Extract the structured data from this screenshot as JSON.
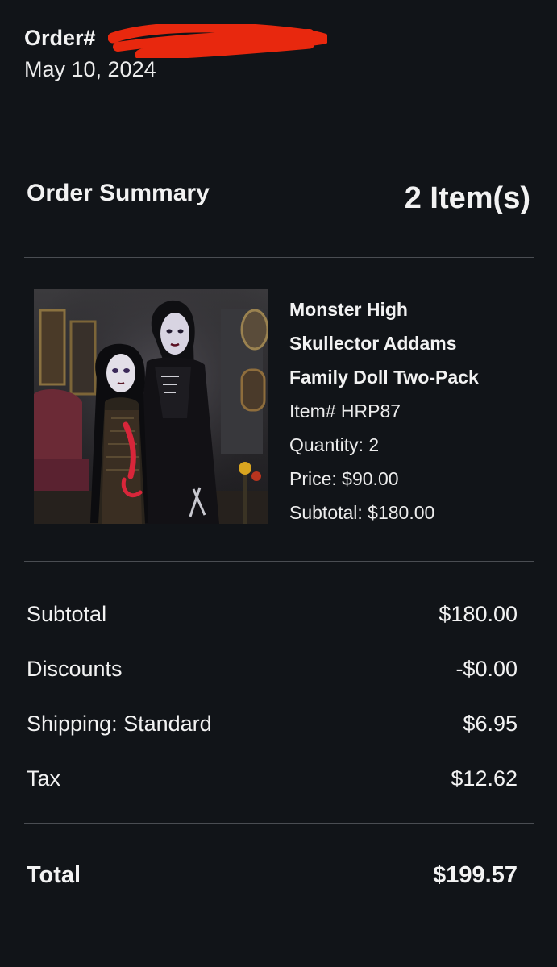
{
  "order": {
    "number_label": "Order#",
    "date": "May 10, 2024"
  },
  "summary": {
    "title": "Order Summary",
    "item_count": "2 Item(s)"
  },
  "item": {
    "name_line1": "Monster High",
    "name_line2": "Skullector Addams",
    "name_line3": "Family Doll Two-Pack",
    "item_number": "Item# HRP87",
    "quantity": "Quantity: 2",
    "price": "Price:  $90.00",
    "subtotal": "Subtotal: $180.00"
  },
  "totals": {
    "subtotal_label": "Subtotal",
    "subtotal_value": "$180.00",
    "discounts_label": "Discounts",
    "discounts_value": "-$0.00",
    "shipping_label": "Shipping: Standard",
    "shipping_value": "$6.95",
    "tax_label": "Tax",
    "tax_value": "$12.62",
    "total_label": "Total",
    "total_value": "$199.57"
  },
  "colors": {
    "background": "#111418",
    "text": "#f2f2f2",
    "divider": "#4a4d52",
    "redaction": "#e8280e"
  }
}
